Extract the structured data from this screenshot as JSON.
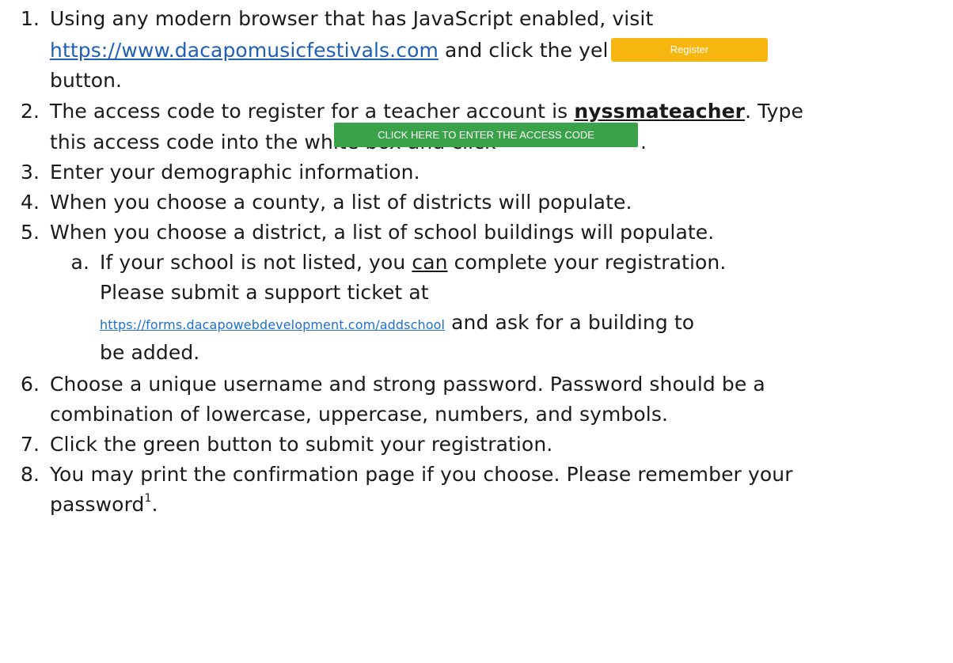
{
  "steps": {
    "s1": {
      "num": "1.",
      "a": "Using any modern browser that has JavaScript enabled, visit",
      "link": "https://www.dacapomusicfestivals.com",
      "b": " and click the yellow",
      "c": "button.",
      "button_label": "Register"
    },
    "s2": {
      "num": "2.",
      "a": "The access code to register for a teacher account is ",
      "code": "nyssmateacher",
      "b": ".  Type",
      "c": "this access code into the white box and click",
      "d": ".",
      "button_label": "CLICK HERE TO ENTER THE ACCESS CODE"
    },
    "s3": {
      "num": "3.",
      "text": "Enter your demographic information."
    },
    "s4": {
      "num": "4.",
      "text": "When you choose a county, a list of districts will populate."
    },
    "s5": {
      "num": "5.",
      "text": "When you choose a district, a list of school buildings will populate.",
      "sub": {
        "num": "a.",
        "a": "If your school is not listed, you ",
        "can": "can",
        "b": " complete your registration.",
        "c": "Please submit a support ticket at",
        "link": "https://forms.dacapowebdevelopment.com/addschool",
        "d": " and ask for a building to",
        "e": "be added."
      }
    },
    "s6": {
      "num": "6.",
      "a": "Choose a unique username and strong password.  Password should be a",
      "b": "combination of lowercase, uppercase, numbers, and symbols."
    },
    "s7": {
      "num": "7.",
      "text": "Click the green button to submit your registration."
    },
    "s8": {
      "num": "8.",
      "a": "You may print the confirmation page if you choose.  Please remember your",
      "b": "password",
      "footnote": "1",
      "c": "."
    }
  },
  "colors": {
    "register_button": "#f7b50f",
    "access_button": "#3aa34a",
    "link": "#1f5fb5"
  }
}
